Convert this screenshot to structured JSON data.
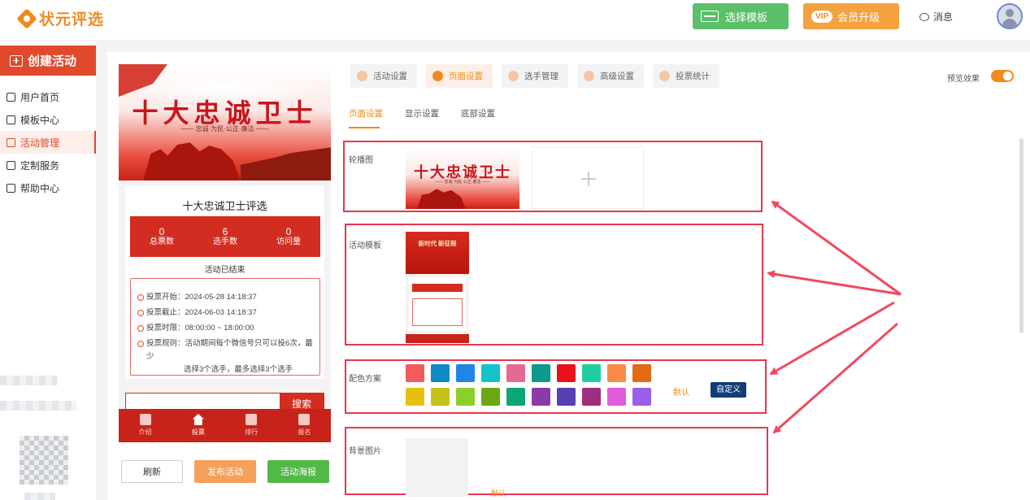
{
  "brand": {
    "name": "状元评选"
  },
  "header": {
    "template_label": "选择模板",
    "vip_badge": "VIP",
    "vip_label": "会员升级",
    "messages_label": "消息"
  },
  "sidebar": {
    "create_label": "创建活动",
    "items": [
      {
        "label": "用户首页",
        "icon": "home-icon"
      },
      {
        "label": "模板中心",
        "icon": "folder-icon"
      },
      {
        "label": "活动管理",
        "icon": "ticket-icon",
        "active": true
      },
      {
        "label": "定制服务",
        "icon": "puzzle-icon"
      },
      {
        "label": "帮助中心",
        "icon": "help-icon"
      }
    ]
  },
  "preview": {
    "banner_title": "十大忠诚卫士",
    "banner_subtitle": "—— 忠诚·为民·公正·廉洁 ——",
    "activity_name": "十大忠诚卫士评选",
    "stats": [
      {
        "value": "0",
        "label": "总票数"
      },
      {
        "value": "6",
        "label": "选手数"
      },
      {
        "value": "0",
        "label": "访问量"
      }
    ],
    "status": "活动已结束",
    "info": {
      "start": "投票开始：2024-05-28 14:18:37",
      "end": "投票截止：2024-06-03 14:18:37",
      "hours": "投票时限：08:00:00 ~ 18:00:00",
      "rules_line1": "投票规则：活动期间每个微信号只可以投6次，最少",
      "rules_line2": "选择3个选手，最多选择3个选手"
    },
    "search_label": "搜索",
    "tabs": [
      {
        "label": "介绍"
      },
      {
        "label": "投票",
        "active": true
      },
      {
        "label": "排行"
      },
      {
        "label": "报名"
      }
    ]
  },
  "actions": {
    "refresh": "刷新",
    "publish": "发布活动",
    "poster": "活动海报"
  },
  "settings_tabs": [
    {
      "label": "活动设置"
    },
    {
      "label": "页面设置",
      "active": true
    },
    {
      "label": "选手管理"
    },
    {
      "label": "高级设置"
    },
    {
      "label": "投票统计"
    }
  ],
  "preview_effect_label": "预览效果",
  "preview_effect_on": true,
  "sub_tabs": [
    {
      "label": "页面设置",
      "active": true
    },
    {
      "label": "显示设置"
    },
    {
      "label": "底部设置"
    }
  ],
  "sections": {
    "carousel_label": "轮播图",
    "carousel_thumb_title": "十大忠诚卫士",
    "carousel_thumb_sub": "—— 忠诚·为民·公正·廉洁 ——",
    "template_label": "活动模板",
    "template_thumb_title": "新时代 新征程",
    "colors_label": "配色方案",
    "colors": [
      "#f15b5b",
      "#0f8ac4",
      "#1f86e8",
      "#15c2c9",
      "#e46a96",
      "#0b9a8c",
      "#e6131b",
      "#1fcea0",
      "#fb8a45",
      "#e56910",
      "#e5c013",
      "#c7c21a",
      "#8ccf2a",
      "#6aa812",
      "#0aa676",
      "#8b3ba8",
      "#5640b4",
      "#a02e7e",
      "#e25bdb",
      "#9a5fe8"
    ],
    "default_label": "默认",
    "custom_label": "自定义",
    "bg_label": "背景图片",
    "bg_default_label": "默认"
  }
}
